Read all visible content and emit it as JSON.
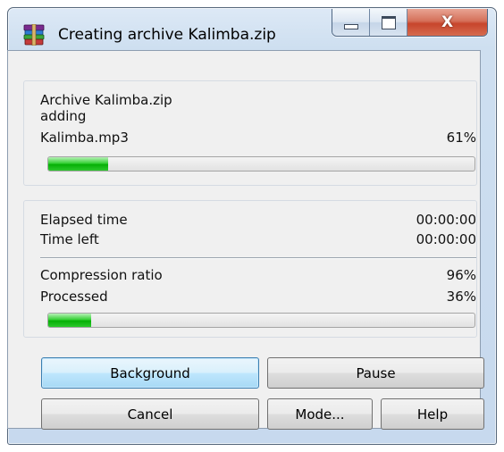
{
  "window": {
    "title": "Creating archive Kalimba.zip",
    "app_icon": "winrar-books-icon",
    "controls": {
      "minimize": "minimize-icon",
      "maximize": "maximize-icon",
      "close_symbol": "X"
    }
  },
  "archive_info": {
    "archive_line": "Archive Kalimba.zip",
    "action": "adding",
    "current_file": "Kalimba.mp3",
    "file_percent": "61%",
    "file_progress": 0.14
  },
  "stats": {
    "elapsed_label": "Elapsed time",
    "elapsed_value": "00:00:00",
    "time_left_label": "Time left",
    "time_left_value": "00:00:00",
    "ratio_label": "Compression ratio",
    "ratio_value": "96%",
    "processed_label": "Processed",
    "processed_value": "36%",
    "total_progress": 0.1
  },
  "buttons": {
    "background": "Background",
    "pause": "Pause",
    "cancel": "Cancel",
    "mode": "Mode...",
    "help": "Help"
  },
  "colors": {
    "progress_green": "#07b007",
    "default_button_border": "#3c7fb1",
    "close_button_red": "#c7452c"
  }
}
